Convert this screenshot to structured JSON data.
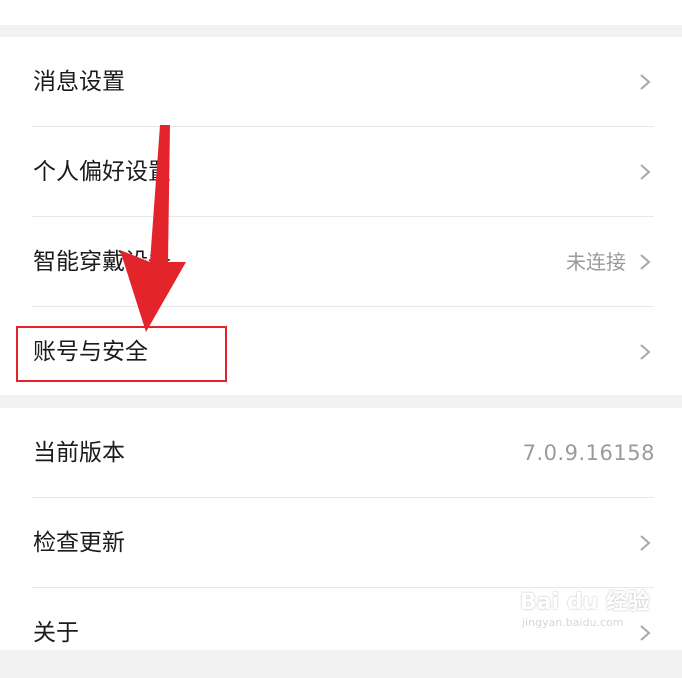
{
  "settings": {
    "group1": [
      {
        "label": "消息设置",
        "value": "",
        "has_chevron": true
      },
      {
        "label": "个人偏好设置",
        "value": "",
        "has_chevron": true
      },
      {
        "label": "智能穿戴设备",
        "value": "未连接",
        "has_chevron": true
      },
      {
        "label": "账号与安全",
        "value": "",
        "has_chevron": true
      }
    ],
    "group2": [
      {
        "label": "当前版本",
        "value": "7.0.9.16158",
        "has_chevron": false
      },
      {
        "label": "检查更新",
        "value": "",
        "has_chevron": true
      },
      {
        "label": "关于",
        "value": "",
        "has_chevron": true
      }
    ]
  },
  "annotation": {
    "highlight_color": "#e3242b",
    "highlighted_item": "账号与安全"
  },
  "watermark": {
    "brand": "Bai du 经验",
    "url": "jingyan.baidu.com"
  },
  "colors": {
    "background": "#f2f2f2",
    "card": "#ffffff",
    "label": "#1b1b1b",
    "secondary": "#9b9b9b",
    "chevron": "#a8a8a8"
  }
}
